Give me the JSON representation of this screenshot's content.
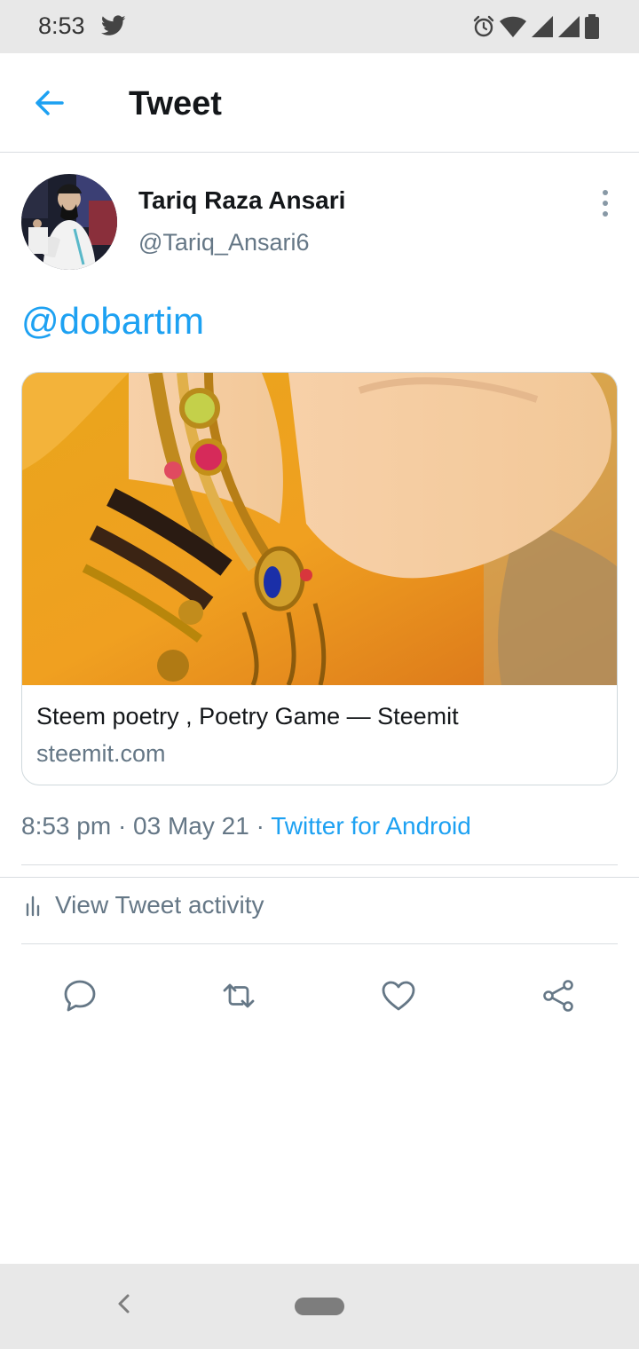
{
  "status_bar": {
    "time": "8:53",
    "icons": [
      "twitter-bird-icon",
      "alarm-icon",
      "wifi-icon",
      "signal-icon",
      "signal-icon",
      "battery-icon"
    ]
  },
  "header": {
    "back_icon": "arrow-left-icon",
    "title": "Tweet"
  },
  "tweet": {
    "author": {
      "name": "Tariq Raza Ansari",
      "handle": "@Tariq_Ansari6",
      "avatar": "avatar-photo"
    },
    "more_icon": "vertical-dots-icon",
    "text": "@dobartim",
    "card": {
      "image": "bangles-photo",
      "title": "Steem poetry , Poetry Game — Steemit",
      "domain": "steemit.com"
    },
    "timestamp": "8:53 pm · 03 May 21 · ",
    "source": "Twitter for Android",
    "activity_label": "View Tweet activity",
    "actions": [
      "reply-icon",
      "retweet-icon",
      "like-icon",
      "share-icon"
    ]
  },
  "nav_bar": {
    "back_icon": "chevron-left-icon",
    "home_icon": "home-pill-icon"
  },
  "colors": {
    "accent": "#1da1f2",
    "text_primary": "#14171a",
    "text_secondary": "#657786",
    "divider": "#d9dde1",
    "system_bar": "#e8e8e8"
  }
}
